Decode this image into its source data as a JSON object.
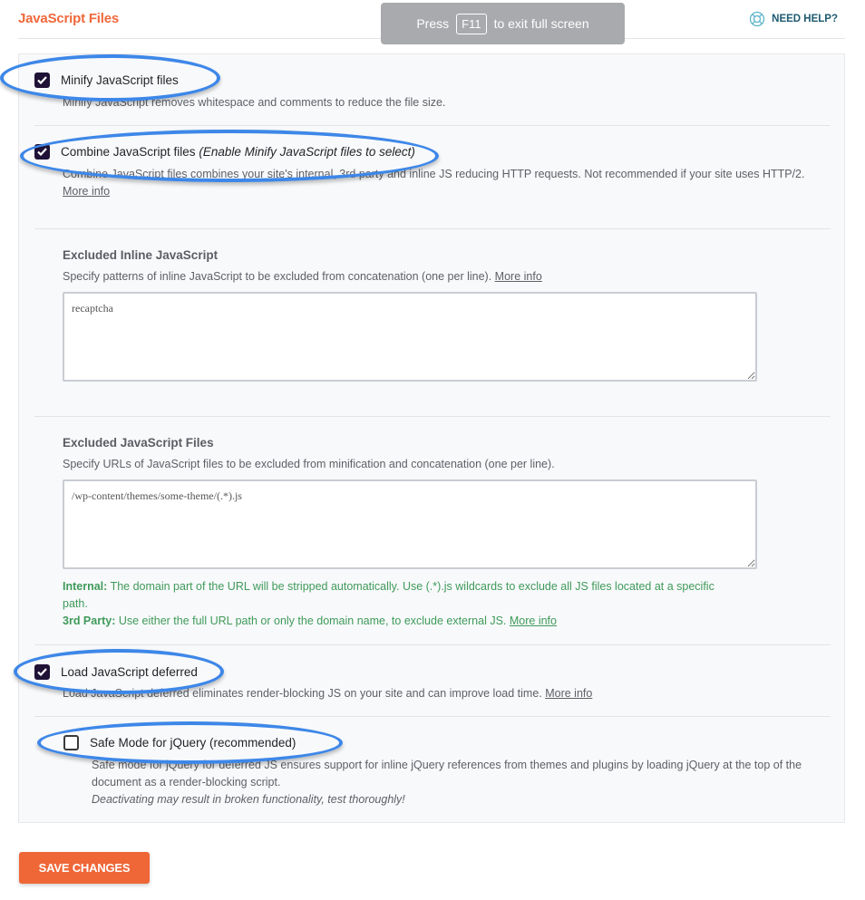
{
  "header": {
    "title": "JavaScript Files",
    "help_label": "NEED HELP?",
    "help_icon": "lifebuoy-icon"
  },
  "fullscreen_banner": {
    "prefix": "Press",
    "key": "F11",
    "suffix": "to exit full screen"
  },
  "options": {
    "minify": {
      "checked": true,
      "label": "Minify JavaScript files",
      "description": "Minify JavaScript removes whitespace and comments to reduce the file size."
    },
    "combine": {
      "checked": true,
      "label": "Combine JavaScript files",
      "hint": "(Enable Minify JavaScript files to select)",
      "description": "Combine JavaScript files combines your site's internal, 3rd party and inline JS reducing HTTP requests. Not recommended if your site uses HTTP/2.",
      "more_info": "More info"
    },
    "excluded_inline": {
      "title": "Excluded Inline JavaScript",
      "description": "Specify patterns of inline JavaScript to be excluded from concatenation (one per line).",
      "more_info": "More info",
      "value": "recaptcha"
    },
    "excluded_files": {
      "title": "Excluded JavaScript Files",
      "description": "Specify URLs of JavaScript files to be excluded from minification and concatenation (one per line).",
      "value": "/wp-content/themes/some-theme/(.*).js",
      "internal_label": "Internal:",
      "internal_text": "The domain part of the URL will be stripped automatically. Use (.*).js wildcards to exclude all JS files located at a specific path.",
      "third_party_label": "3rd Party:",
      "third_party_text": "Use either the full URL path or only the domain name, to exclude external JS.",
      "more_info": "More info"
    },
    "defer": {
      "checked": true,
      "label": "Load JavaScript deferred",
      "description": "Load JavaScript deferred eliminates render-blocking JS on your site and can improve load time.",
      "more_info": "More info"
    },
    "safe_mode": {
      "checked": false,
      "label": "Safe Mode for jQuery (recommended)",
      "description": "Safe mode for jQuery for deferred JS ensures support for inline jQuery references from themes and plugins by loading jQuery at the top of the document as a render-blocking script.",
      "warning": "Deactivating may result in broken functionality, test thoroughly!"
    }
  },
  "save_button": "SAVE CHANGES",
  "annotation_color": "#3d87e8",
  "accent_color": "#ef6637"
}
